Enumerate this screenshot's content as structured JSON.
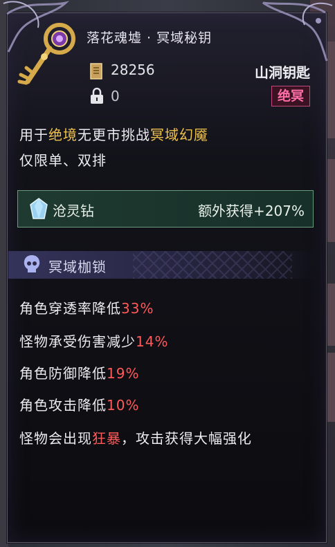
{
  "item": {
    "name": "落花魂墟 · 冥域秘钥",
    "price": "28256",
    "lock_count": "0",
    "type": "山洞钥匙",
    "rarity": "绝冥"
  },
  "description": {
    "line1_a": "用于",
    "line1_b": "绝境",
    "line1_c": "无更市挑战",
    "line1_d": "冥域幻魇",
    "line2": "仅限单、双排"
  },
  "bonus": {
    "gem_name": "沧灵钻",
    "label": "额外获得+207%"
  },
  "section": {
    "title": "冥域枷锁"
  },
  "modifiers": [
    {
      "text": "角色穿透率降低",
      "value": "33%"
    },
    {
      "text": "怪物承受伤害减少",
      "value": "14%"
    },
    {
      "text": "角色防御降低",
      "value": "19%"
    },
    {
      "text": "角色攻击降低",
      "value": "10%"
    },
    {
      "text_a": "怪物会出现",
      "value": "狂暴",
      "text_b": "，攻击获得大幅强化"
    }
  ],
  "colors": {
    "gold_highlight": "#f1c24c",
    "red_value": "#ff5a5a",
    "rarity": "#ff6ea8",
    "bonus_border": "#6d9b7f"
  },
  "icons": [
    "key-icon",
    "price-tag-icon",
    "lock-icon",
    "gem-icon",
    "skull-icon"
  ]
}
